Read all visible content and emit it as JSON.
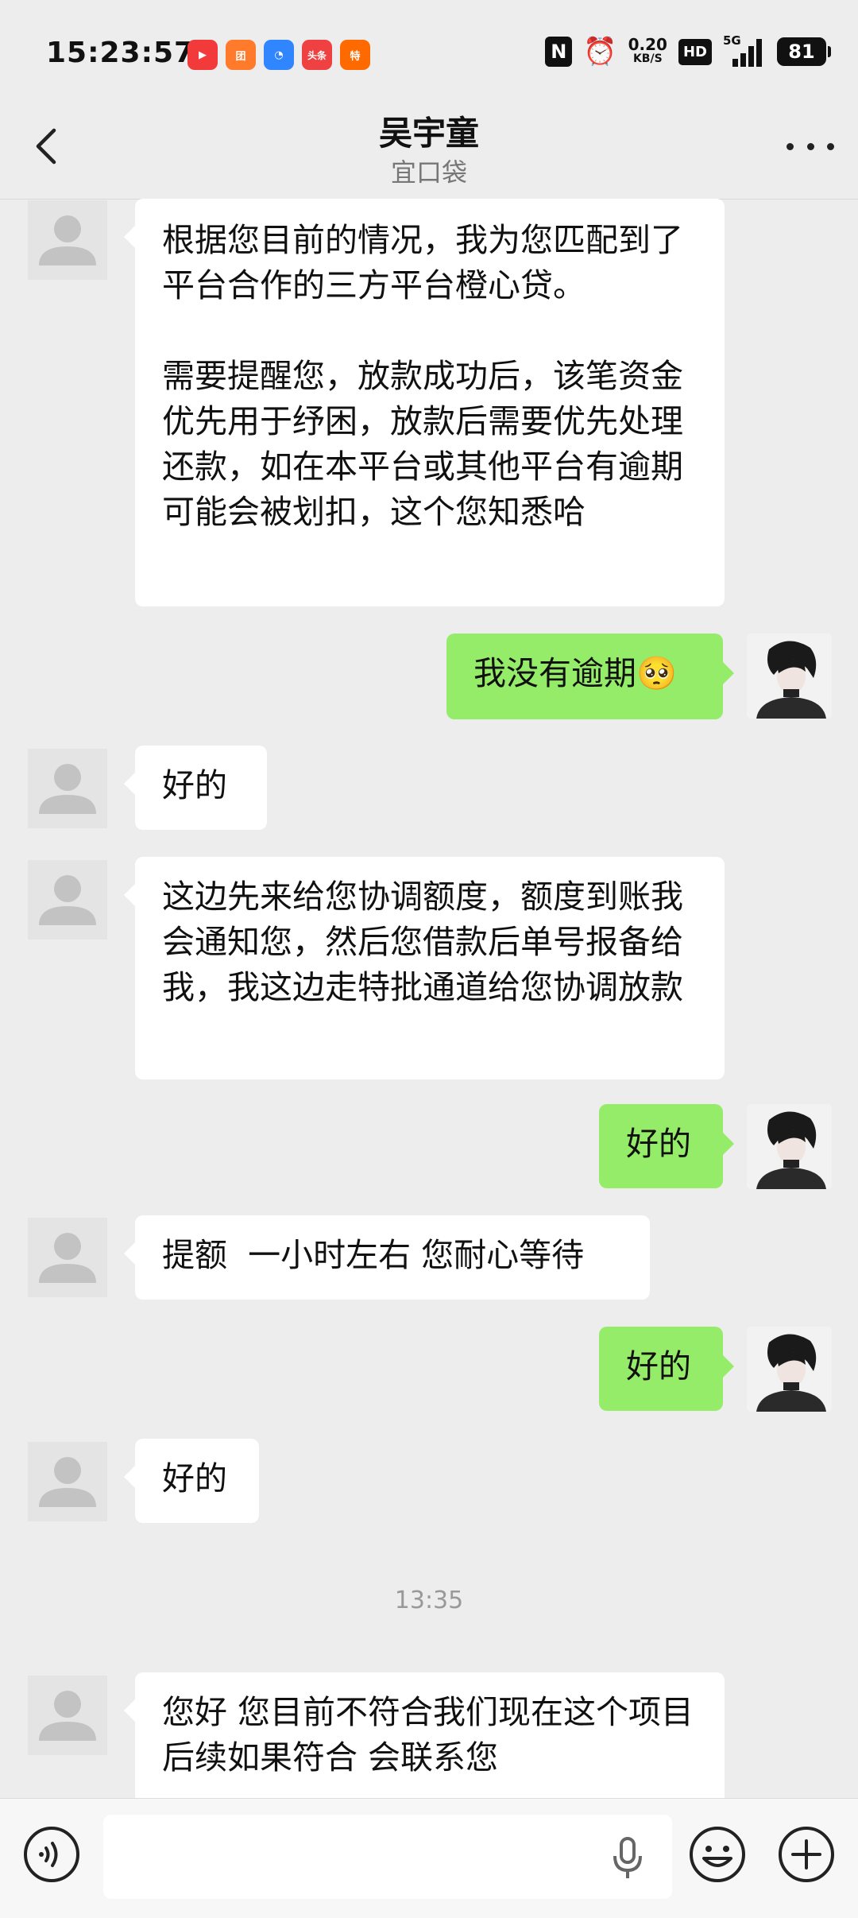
{
  "status_bar": {
    "time": "15:23:57",
    "apps": [
      {
        "icon": "video-app-icon",
        "label": "▶",
        "color": "#f23a3a"
      },
      {
        "icon": "shopping-app-icon",
        "label": "团",
        "color": "#ff7a2a"
      },
      {
        "icon": "browser-app-icon",
        "label": "◔",
        "color": "#2f86ff"
      },
      {
        "icon": "toutiao-app-icon",
        "label": "头条",
        "color": "#f04142"
      },
      {
        "icon": "taobao-special-app-icon",
        "label": "特",
        "color": "#ff6a00"
      }
    ],
    "network_speed_value": "0.20",
    "network_speed_unit": "KB/S",
    "hd_label": "HD",
    "network_type": "5G",
    "battery": "81"
  },
  "header": {
    "title": "吴宇童",
    "subtitle": "宜口袋"
  },
  "messages": [
    {
      "side": "left",
      "text": "根据您目前的情况，我为您匹配到了平台合作的三方平台橙心贷。\n\n需要提醒您，放款成功后，该笔资金优先用于纾困，放款后需要优先处理还款，如在本平台或其他平台有逾期可能会被划扣，这个您知悉哈"
    },
    {
      "side": "right",
      "text": "我没有逾期🥺"
    },
    {
      "side": "left",
      "text": "好的"
    },
    {
      "side": "left",
      "text": "这边先来给您协调额度，额度到账我会通知您，然后您借款后单号报备给我，我这边走特批通道给您协调放款"
    },
    {
      "side": "right",
      "text": "好的"
    },
    {
      "side": "left",
      "text": "提额  一小时左右 您耐心等待"
    },
    {
      "side": "right",
      "text": "好的"
    },
    {
      "side": "left",
      "text": "好的"
    },
    {
      "side": "left",
      "text": "您好 您目前不符合我们现在这个项目  后续如果符合 会联系您"
    }
  ],
  "timestamp": "13:35",
  "input_bar": {
    "voice_icon": "voice-icon",
    "mic_icon": "mic-icon",
    "emoji_icon": "emoji-icon",
    "plus_icon": "plus-icon"
  }
}
